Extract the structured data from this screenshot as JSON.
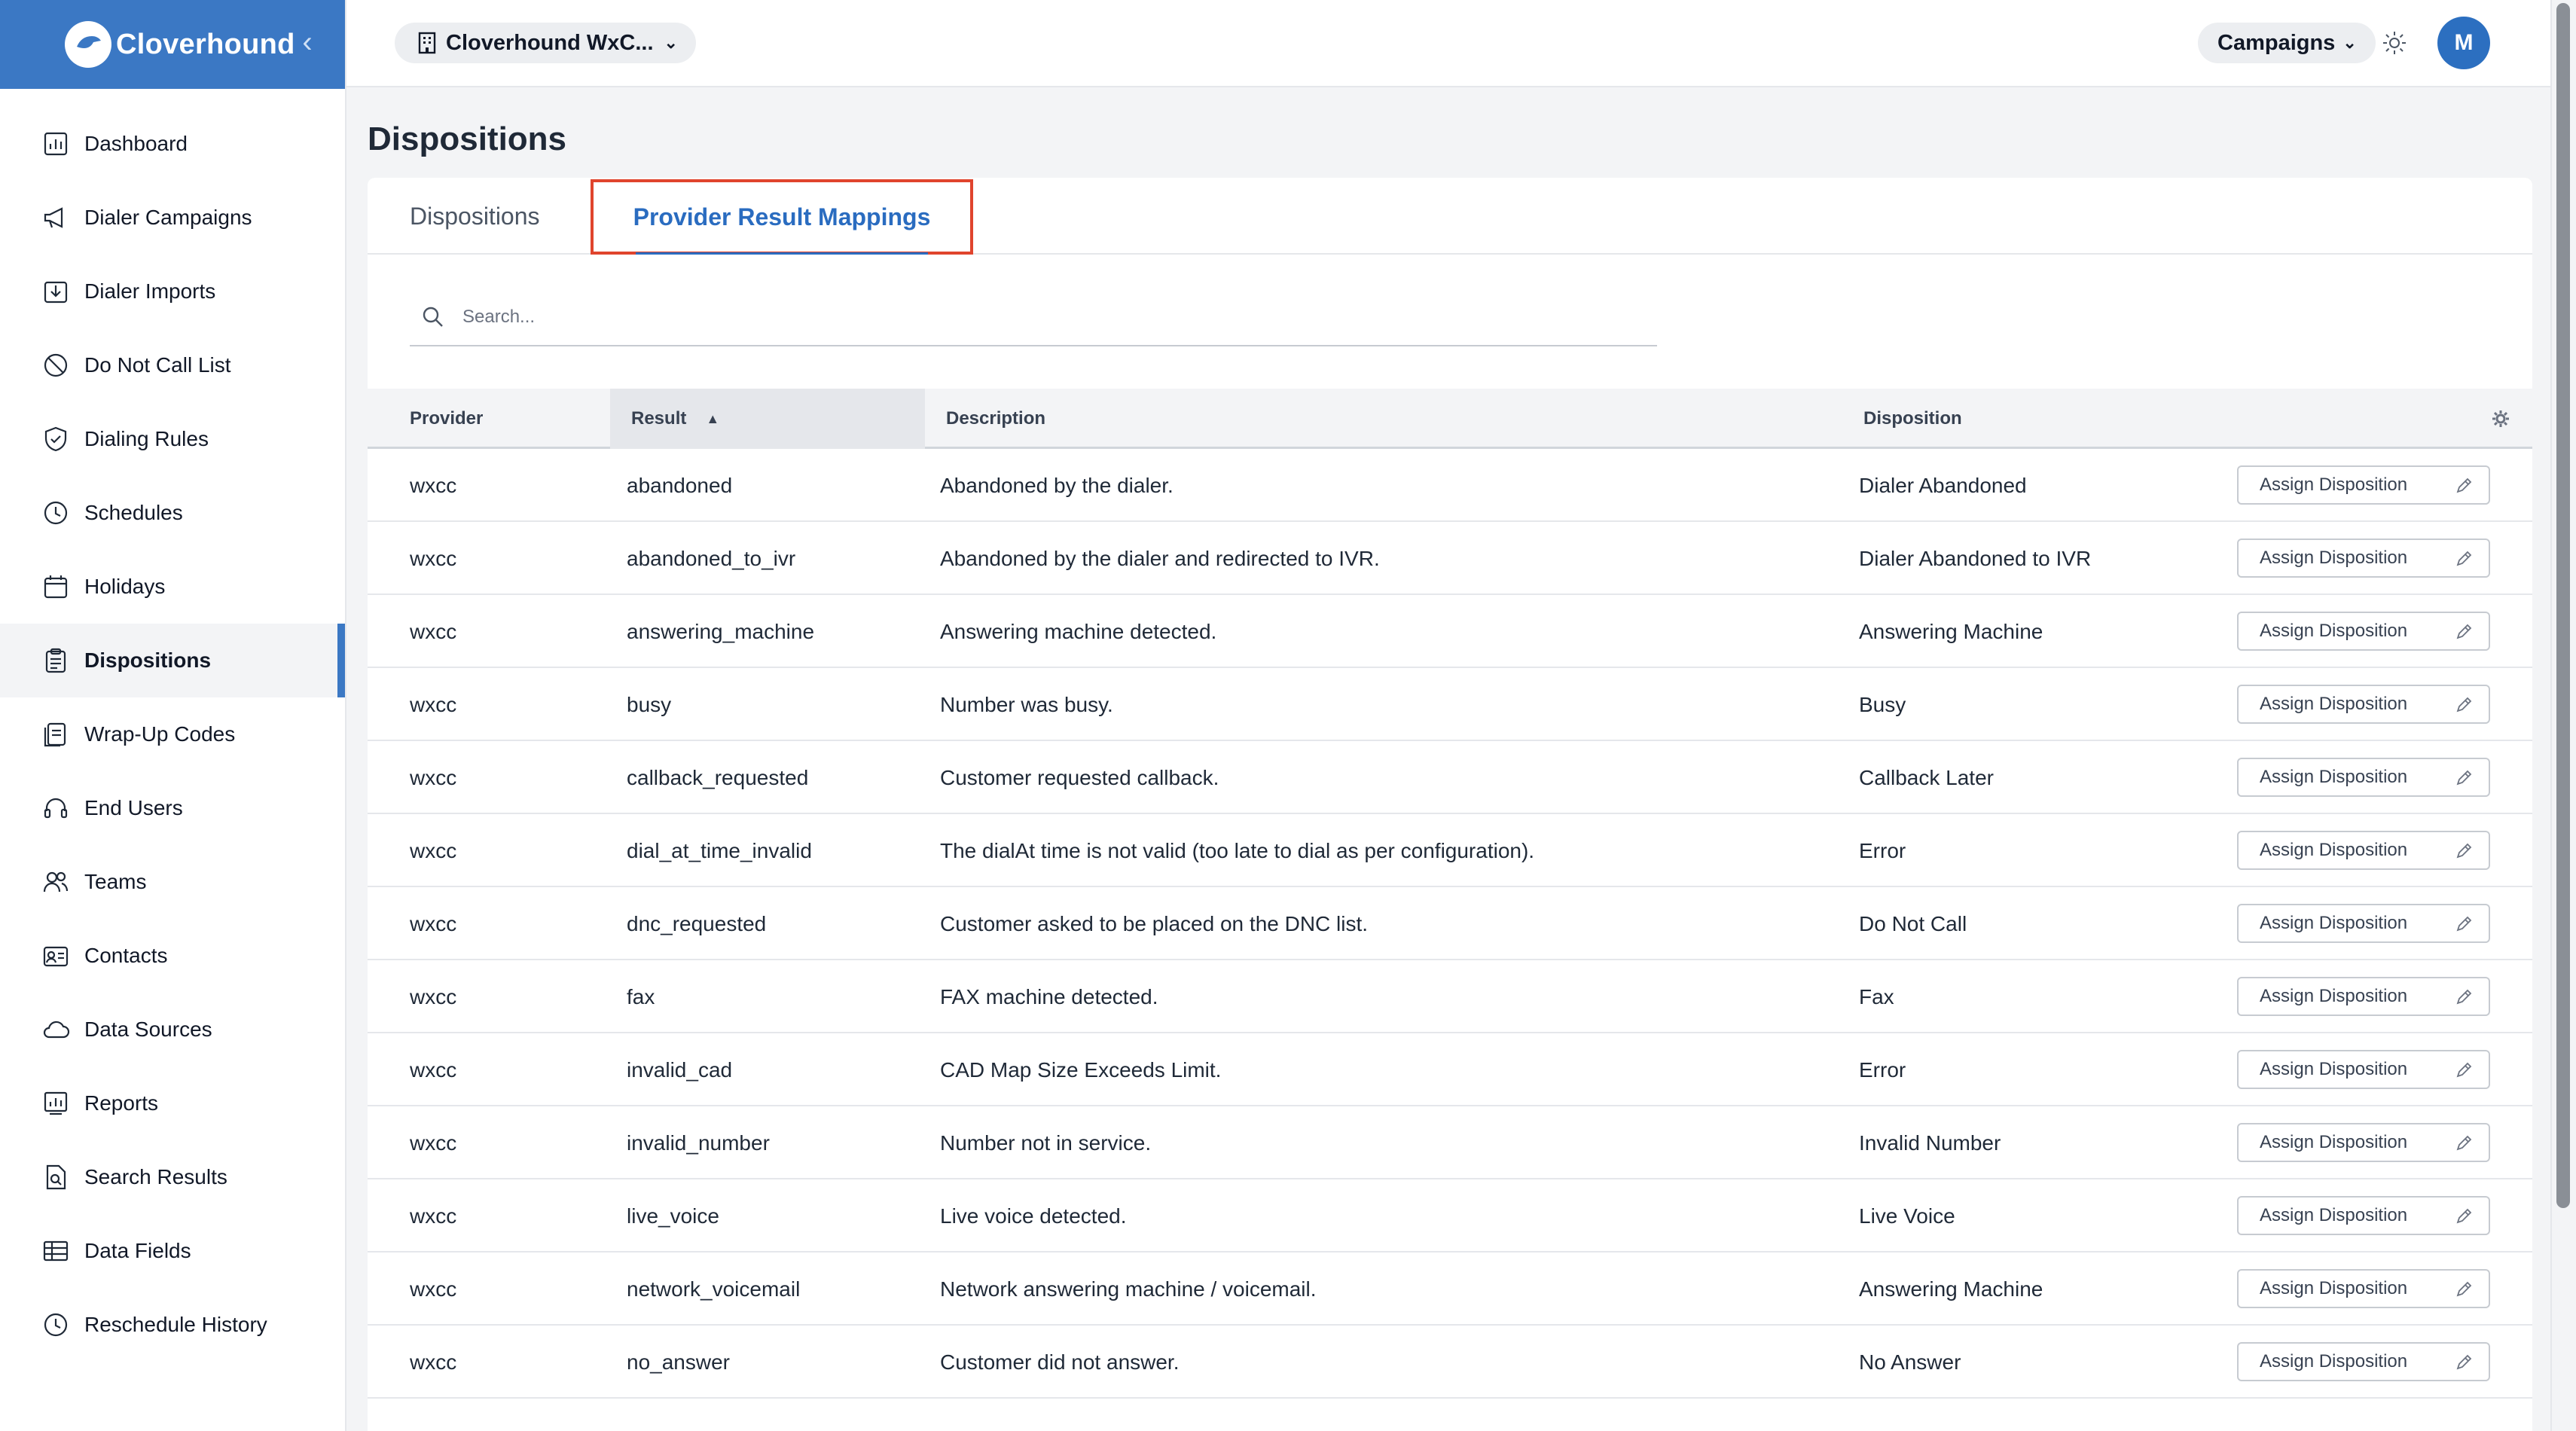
{
  "brand": {
    "name": "Cloverhound"
  },
  "topbar": {
    "org_name": "Cloverhound WxC...",
    "campaigns_label": "Campaigns",
    "avatar_initial": "M"
  },
  "sidebar": {
    "items": [
      {
        "label": "Dashboard",
        "icon": "chart-icon"
      },
      {
        "label": "Dialer Campaigns",
        "icon": "megaphone-icon"
      },
      {
        "label": "Dialer Imports",
        "icon": "import-icon"
      },
      {
        "label": "Do Not Call List",
        "icon": "ban-icon"
      },
      {
        "label": "Dialing Rules",
        "icon": "shield-icon"
      },
      {
        "label": "Schedules",
        "icon": "clock-icon"
      },
      {
        "label": "Holidays",
        "icon": "calendar-icon"
      },
      {
        "label": "Dispositions",
        "icon": "clipboard-icon",
        "active": true
      },
      {
        "label": "Wrap-Up Codes",
        "icon": "wrapup-icon"
      },
      {
        "label": "End Users",
        "icon": "headset-icon"
      },
      {
        "label": "Teams",
        "icon": "users-icon"
      },
      {
        "label": "Contacts",
        "icon": "contact-card-icon"
      },
      {
        "label": "Data Sources",
        "icon": "cloud-icon"
      },
      {
        "label": "Reports",
        "icon": "report-icon"
      },
      {
        "label": "Search Results",
        "icon": "file-search-icon"
      },
      {
        "label": "Data Fields",
        "icon": "table-icon"
      },
      {
        "label": "Reschedule History",
        "icon": "history-icon"
      }
    ]
  },
  "page": {
    "title": "Dispositions"
  },
  "tabs": [
    {
      "label": "Dispositions",
      "active": false
    },
    {
      "label": "Provider Result Mappings",
      "active": true
    }
  ],
  "search": {
    "placeholder": "Search..."
  },
  "table": {
    "columns": [
      "Provider",
      "Result",
      "Description",
      "Disposition"
    ],
    "sorted_column": "Result",
    "sort_direction": "ascending",
    "action_label": "Assign Disposition",
    "rows": [
      {
        "provider": "wxcc",
        "result": "abandoned",
        "description": "Abandoned by the dialer.",
        "disposition": "Dialer Abandoned"
      },
      {
        "provider": "wxcc",
        "result": "abandoned_to_ivr",
        "description": "Abandoned by the dialer and redirected to IVR.",
        "disposition": "Dialer Abandoned to IVR"
      },
      {
        "provider": "wxcc",
        "result": "answering_machine",
        "description": "Answering machine detected.",
        "disposition": "Answering Machine"
      },
      {
        "provider": "wxcc",
        "result": "busy",
        "description": "Number was busy.",
        "disposition": "Busy"
      },
      {
        "provider": "wxcc",
        "result": "callback_requested",
        "description": "Customer requested callback.",
        "disposition": "Callback Later"
      },
      {
        "provider": "wxcc",
        "result": "dial_at_time_invalid",
        "description": "The dialAt time is not valid (too late to dial as per configuration).",
        "disposition": "Error"
      },
      {
        "provider": "wxcc",
        "result": "dnc_requested",
        "description": "Customer asked to be placed on the DNC list.",
        "disposition": "Do Not Call"
      },
      {
        "provider": "wxcc",
        "result": "fax",
        "description": "FAX machine detected.",
        "disposition": "Fax"
      },
      {
        "provider": "wxcc",
        "result": "invalid_cad",
        "description": "CAD Map Size Exceeds Limit.",
        "disposition": "Error"
      },
      {
        "provider": "wxcc",
        "result": "invalid_number",
        "description": "Number not in service.",
        "disposition": "Invalid Number"
      },
      {
        "provider": "wxcc",
        "result": "live_voice",
        "description": "Live voice detected.",
        "disposition": "Live Voice"
      },
      {
        "provider": "wxcc",
        "result": "network_voicemail",
        "description": "Network answering machine / voicemail.",
        "disposition": "Answering Machine"
      },
      {
        "provider": "wxcc",
        "result": "no_answer",
        "description": "Customer did not answer.",
        "disposition": "No Answer"
      }
    ]
  },
  "colors": {
    "brand": "#3b78c4",
    "active_tab": "#2a6cc0",
    "highlight_border": "#e0442d",
    "avatar": "#2c6fc0"
  }
}
